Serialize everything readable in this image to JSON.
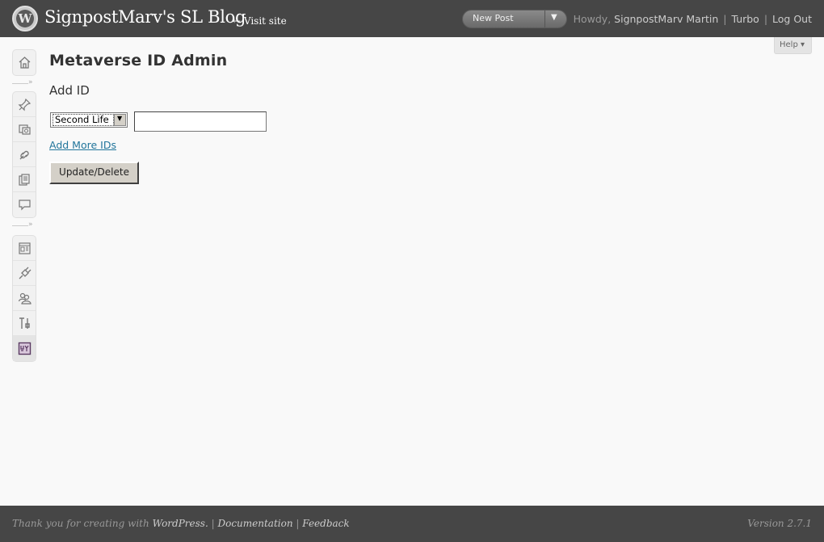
{
  "header": {
    "site_title": "SignpostMarv's SL Blog",
    "visit_site": "← Visit site",
    "new_post_label": "New Post",
    "new_post_arrow": "▼",
    "howdy": "Howdy,",
    "user_name": "SignpostMarv Martin",
    "turbo": "Turbo",
    "logout": "Log Out"
  },
  "help_tab": {
    "label": "Help ▾"
  },
  "sidebar": {
    "items": [
      {
        "icon": "dashboard-icon"
      },
      {
        "icon": "posts-pin-icon"
      },
      {
        "icon": "media-icon"
      },
      {
        "icon": "links-icon"
      },
      {
        "icon": "pages-icon"
      },
      {
        "icon": "comments-icon"
      },
      {
        "icon": "appearance-icon"
      },
      {
        "icon": "plugins-icon"
      },
      {
        "icon": "users-icon"
      },
      {
        "icon": "tools-icon"
      },
      {
        "icon": "settings-icon"
      }
    ]
  },
  "main": {
    "page_title": "Metaverse ID Admin",
    "section_title": "Add ID",
    "network_select_value": "Second Life",
    "id_input_value": "",
    "add_more_link": "Add More IDs",
    "update_button": "Update/Delete"
  },
  "footer": {
    "thanks": "Thank you for creating with",
    "wordpress": "WordPress.",
    "documentation": "Documentation",
    "feedback": "Feedback",
    "version": "Version 2.7.1"
  },
  "colors": {
    "header_bg": "#464646",
    "page_bg": "#f9f9f9",
    "link": "#21759b"
  }
}
